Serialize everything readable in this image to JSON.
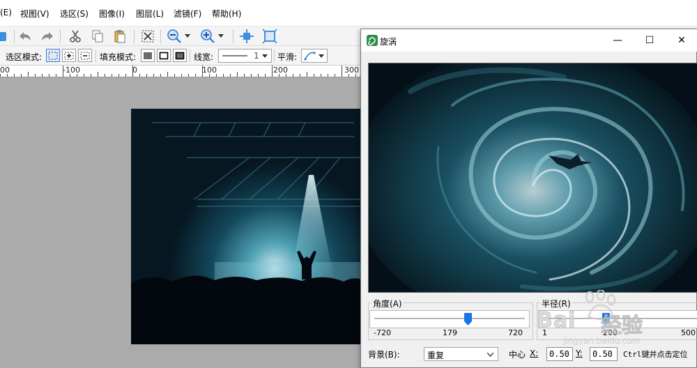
{
  "menubar": {
    "items": [
      "(E)",
      "视图(V)",
      "选区(S)",
      "图像(I)",
      "图层(L)",
      "滤镜(F)",
      "帮助(H)"
    ]
  },
  "toolbar": {
    "icons": [
      "new-doc-icon",
      "undo-icon",
      "redo-icon",
      "cut-icon",
      "copy-icon",
      "paste-icon",
      "deselect-icon",
      "zoom-out-icon",
      "zoom-in-icon",
      "fit-window-icon",
      "actual-size-icon"
    ]
  },
  "options": {
    "selection_mode_label": "选区模式:",
    "fill_mode_label": "填充模式:",
    "line_width_label": "线宽:",
    "line_width_value": "1",
    "smooth_label": "平滑:"
  },
  "ruler": {
    "labels": [
      "00",
      "-100",
      "0",
      "100",
      "200",
      "300"
    ]
  },
  "dialog": {
    "title": "旋涡",
    "minimize": "—",
    "maximize": "☐",
    "close": "✕",
    "angle": {
      "label": "角度(A)",
      "min": "-720",
      "current": "179",
      "max": "720",
      "position_fraction": 0.624
    },
    "radius": {
      "label": "半径(R)",
      "min": "1",
      "current": "200",
      "max": "500",
      "position_fraction": 0.398
    },
    "background": {
      "label": "背景(B):",
      "value": "重复"
    },
    "center": {
      "label": "中心",
      "x_label": "X:",
      "x_value": "0.50",
      "y_label": "Y:",
      "y_value": "0.50",
      "hint": "Ctrl键并点击定位"
    }
  },
  "watermark": {
    "brand": "Bai",
    "brand2": "经验",
    "url": "jingyan.baidu.com"
  },
  "colors": {
    "accent": "#1a73e8",
    "dialog_bg": "#f0f0f0",
    "canvas_bg": "#ababab"
  }
}
